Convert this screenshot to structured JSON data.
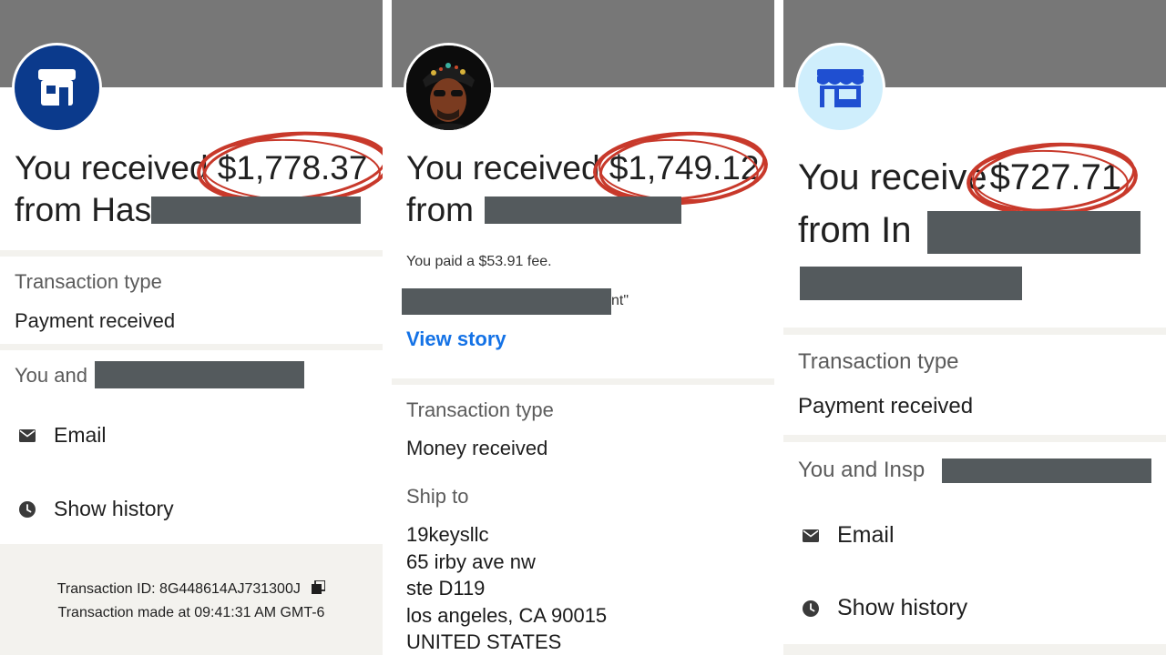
{
  "panels": [
    {
      "headline_prefix": "You received ",
      "amount": "$1,778.37",
      "from_text": "from Has",
      "transaction_type_label": "Transaction type",
      "transaction_type_value": "Payment received",
      "you_and": "You and",
      "email_label": "Email",
      "history_label": "Show history",
      "transaction_id": "Transaction ID: 8G448614AJ731300J",
      "transaction_time": "Transaction made at 09:41:31 AM GMT-6",
      "colors": {
        "avatar_bg": "#0b3a8c",
        "circle": "#c8392b"
      }
    },
    {
      "headline_prefix": "You received ",
      "amount": "$1,749.12",
      "from_text": "from",
      "fee_text": "You paid a $53.91 fee.",
      "note_tail": "nt\"",
      "view_story": "View story",
      "transaction_type_label": "Transaction type",
      "transaction_type_value": "Money received",
      "ship_to_label": "Ship to",
      "address_lines": [
        "19keysllc",
        "65 irby ave nw",
        "ste D119",
        "los angeles, CA 90015",
        "UNITED STATES"
      ],
      "colors": {
        "circle": "#c8392b"
      }
    },
    {
      "headline_prefix": "You receive",
      "amount": "$727.71",
      "from_text": "from In",
      "transaction_type_label": "Transaction type",
      "transaction_type_value": "Payment received",
      "you_and": "You and Insp",
      "email_label": "Email",
      "history_label": "Show history",
      "colors": {
        "avatar_bg": "#cfeefc",
        "icon": "#1f4fd1",
        "circle": "#c8392b"
      }
    }
  ]
}
